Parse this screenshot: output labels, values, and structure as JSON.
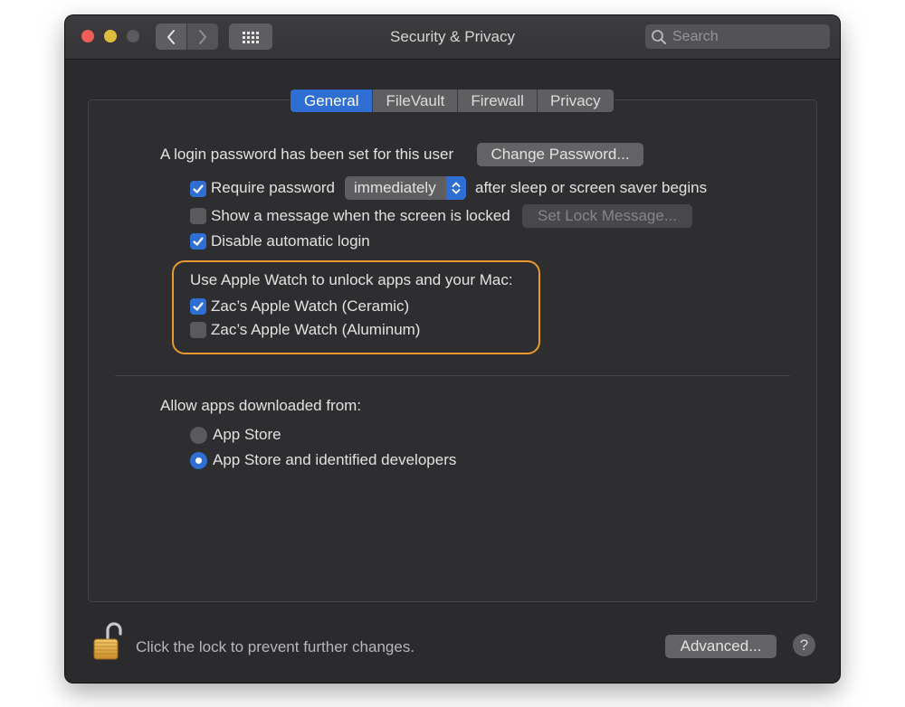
{
  "window": {
    "title": "Security & Privacy"
  },
  "search": {
    "placeholder": "Search"
  },
  "tabs": [
    {
      "label": "General",
      "active": true
    },
    {
      "label": "FileVault",
      "active": false
    },
    {
      "label": "Firewall",
      "active": false
    },
    {
      "label": "Privacy",
      "active": false
    }
  ],
  "general": {
    "login_text": "A login password has been set for this user",
    "change_password_label": "Change Password...",
    "require_password": {
      "label": "Require password",
      "checked": true,
      "value": "immediately",
      "suffix": "after sleep or screen saver begins"
    },
    "show_message": {
      "label": "Show a message when the screen is locked",
      "checked": false,
      "button_label": "Set Lock Message..."
    },
    "disable_auto_login": {
      "label": "Disable automatic login",
      "checked": true
    },
    "apple_watch": {
      "heading": "Use Apple Watch to unlock apps and your Mac:",
      "items": [
        {
          "label": "Zac’s Apple Watch (Ceramic)",
          "checked": true
        },
        {
          "label": "Zac’s Apple Watch (Aluminum)",
          "checked": false
        }
      ]
    },
    "allow_apps": {
      "heading": "Allow apps downloaded from:",
      "options": [
        {
          "label": "App Store",
          "selected": false
        },
        {
          "label": "App Store and identified developers",
          "selected": true
        }
      ]
    }
  },
  "footer": {
    "lock_text": "Click the lock to prevent further changes.",
    "advanced_label": "Advanced...",
    "help_label": "?"
  },
  "colors": {
    "accent": "#2f6ed3",
    "highlight": "#e8982f",
    "window_bg": "#2b2b2d"
  }
}
